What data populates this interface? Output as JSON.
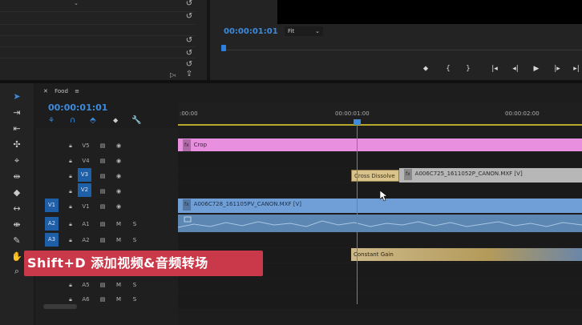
{
  "monitor": {
    "timecode": "00:00:01:01",
    "fit_label": "Fit",
    "transport": [
      "marker",
      "in",
      "out",
      "go-in",
      "step-back",
      "play",
      "step-forward",
      "go-out"
    ]
  },
  "timeline": {
    "sequence_name": "Food",
    "timecode": "00:00:01:01",
    "ruler_labels": [
      ":00:00",
      "00:00:01:00",
      "00:00:02:00"
    ],
    "video_tracks": [
      {
        "name": "V5",
        "sel": ""
      },
      {
        "name": "V4",
        "sel": ""
      },
      {
        "name": "V3",
        "sel": "V3"
      },
      {
        "name": "V2",
        "sel": "V2"
      },
      {
        "name": "V1",
        "sel": "V1"
      }
    ],
    "audio_tracks": [
      {
        "name": "A1",
        "sel": "A2",
        "m": "M",
        "s": "S"
      },
      {
        "name": "A2",
        "sel": "A3",
        "m": "M",
        "s": "S"
      },
      {
        "name": "A3",
        "sel": "",
        "m": "M",
        "s": "S"
      },
      {
        "name": "A5",
        "sel": "",
        "m": "M",
        "s": "S"
      },
      {
        "name": "A6",
        "sel": "",
        "m": "M",
        "s": "S"
      }
    ],
    "clips": {
      "crop": "Crop",
      "cross_dissolve": "Cross Dissolve",
      "v2_clip": "A006C725_1611052P_CANON.MXF [V]",
      "v1_clip": "A006C728_161105PV_CANON.MXF [V]",
      "constant_gain": "Constant Gain"
    },
    "fx_badge": "fx",
    "colors": {
      "adjustment_clip": "#e88fe0",
      "video_clip": "#6f9fd6",
      "audio_clip": "#5c87b2",
      "track_select": "#1f5fa8",
      "playhead": "#3d8bdc",
      "caption_bg": "#c9394a"
    }
  },
  "caption": "Shift+D 添加视频&音频转场"
}
